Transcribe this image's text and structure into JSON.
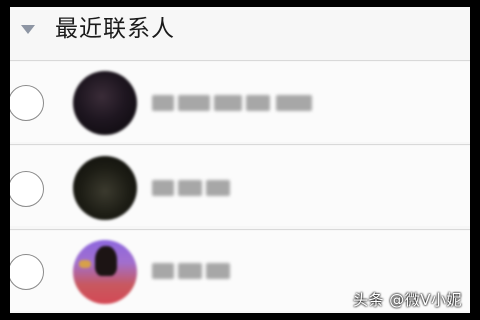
{
  "section": {
    "title": "最近联系人",
    "collapse_icon": "triangle-down-icon"
  },
  "contacts": [
    {
      "avatar": "avatar-dark"
    },
    {
      "avatar": "avatar-dark-olive"
    },
    {
      "avatar": "avatar-purple-red"
    }
  ],
  "watermark": "头条 @微V小妮"
}
